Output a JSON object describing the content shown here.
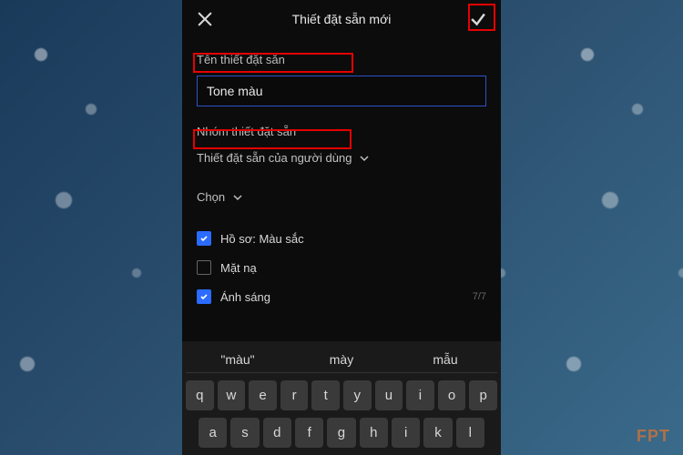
{
  "header": {
    "title": "Thiết đặt sẵn mới"
  },
  "sections": {
    "preset_name_label": "Tên thiết đặt sẵn",
    "preset_name_value": "Tone màu",
    "preset_group_label": "Nhóm thiết đặt sẵn",
    "preset_group_value": "Thiết đặt sẵn của người dùng",
    "select_label": "Chọn"
  },
  "checkboxes": {
    "profile_color": {
      "label": "Hồ sơ: Màu sắc",
      "checked": true
    },
    "mask": {
      "label": "Mặt nạ",
      "checked": false
    },
    "light": {
      "label": "Ánh sáng",
      "checked": true,
      "counter": "7/7"
    }
  },
  "keyboard": {
    "suggestions": [
      "\"màu\"",
      "mày",
      "mẫu"
    ],
    "row1": [
      "q",
      "w",
      "e",
      "r",
      "t",
      "y",
      "u",
      "i",
      "o",
      "p"
    ],
    "row2": [
      "a",
      "s",
      "d",
      "f",
      "g",
      "h",
      "i",
      "k",
      "l"
    ]
  },
  "watermark": "FPT"
}
